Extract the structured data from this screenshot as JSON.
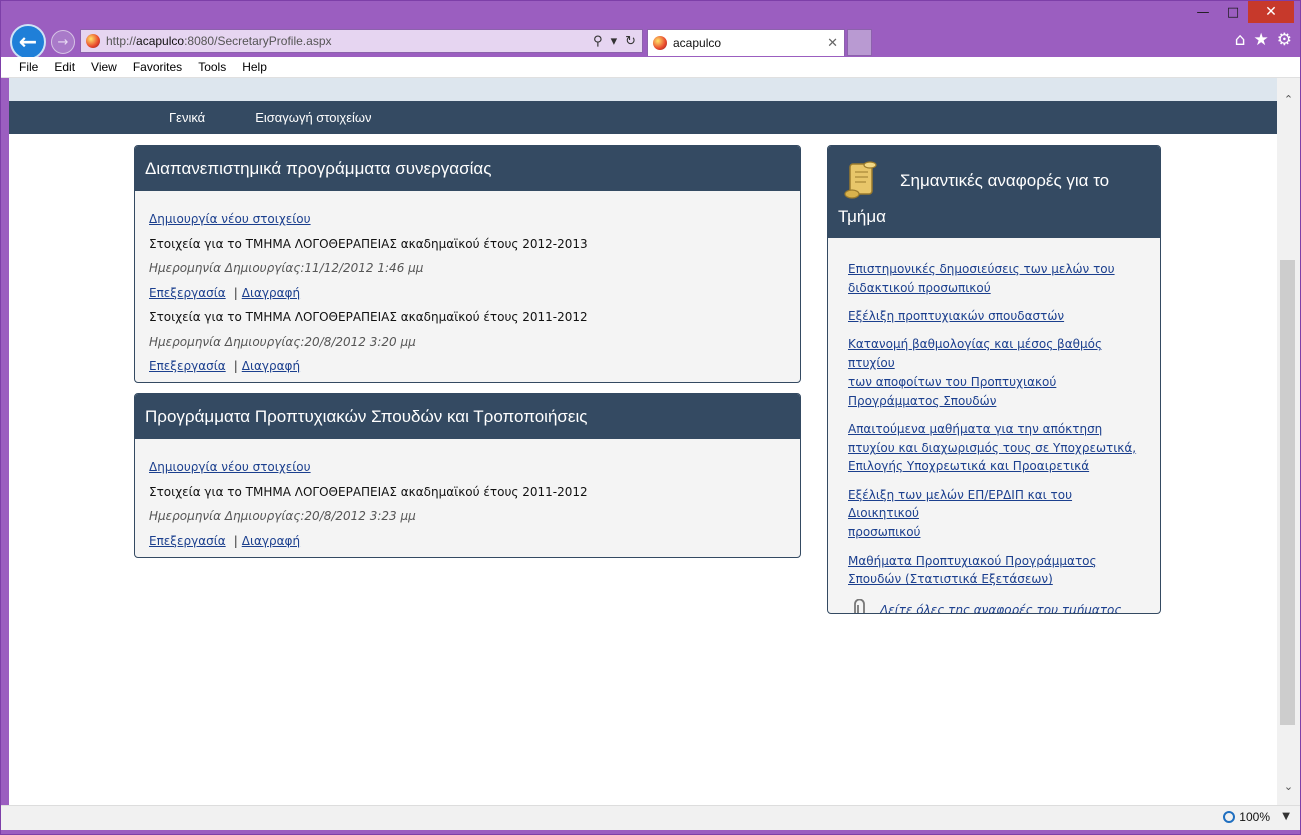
{
  "browser": {
    "url_prefix": "http://",
    "url_host": "acapulco",
    "url_rest": ":8080/SecretaryProfile.aspx",
    "tab_title": "acapulco",
    "menu": [
      "File",
      "Edit",
      "View",
      "Favorites",
      "Tools",
      "Help"
    ],
    "zoom": "100%"
  },
  "nav": {
    "items": [
      "Γενικά",
      "Εισαγωγή στοιχείων"
    ]
  },
  "panel1": {
    "title": "Διαπανεπιστημικά προγράμματα συνεργασίας",
    "create_link": "Δημιουργία νέου στοιχείου",
    "entries": [
      {
        "text": "Στοιχεία για το ΤΜΗΜΑ ΛΟΓΟΘΕΡΑΠΕΙΑΣ ακαδημαϊκού έτους 2012-2013",
        "date": "Ημερομηνία Δημιουργίας:11/12/2012 1:46 μμ",
        "edit": "Επεξεργασία",
        "delete": "Διαγραφή",
        "sep": "|"
      },
      {
        "text": "Στοιχεία για το ΤΜΗΜΑ ΛΟΓΟΘΕΡΑΠΕΙΑΣ ακαδημαϊκού έτους 2011-2012",
        "date": "Ημερομηνία Δημιουργίας:20/8/2012 3:20 μμ",
        "edit": "Επεξεργασία",
        "delete": "Διαγραφή",
        "sep": "|"
      }
    ]
  },
  "panel2": {
    "title": "Προγράμματα Προπτυχιακών Σπουδών και Τροποποιήσεις",
    "create_link": "Δημιουργία νέου στοιχείου",
    "entries": [
      {
        "text": "Στοιχεία για το ΤΜΗΜΑ ΛΟΓΟΘΕΡΑΠΕΙΑΣ ακαδημαϊκού έτους 2011-2012",
        "date": "Ημερομηνία Δημιουργίας:20/8/2012 3:23 μμ",
        "edit": "Επεξεργασία",
        "delete": "Διαγραφή",
        "sep": "|"
      }
    ]
  },
  "reports": {
    "title_line1": "Σημαντικές αναφορές για το",
    "title_line2": "Τμήμα",
    "links": [
      [
        "Επιστημονικές δημοσιεύσεις των μελών του",
        "διδακτικού προσωπικού"
      ],
      [
        "Εξέλιξη προπτυχιακών σπουδαστών"
      ],
      [
        "Κατανομή βαθμολογίας και μέσος βαθμός πτυχίου",
        "των αποφοίτων του Προπτυχιακού",
        "Προγράμματος Σπουδών"
      ],
      [
        "Απαιτούμενα μαθήματα για την απόκτηση",
        "πτυχίου και διαχωρισμός τους σε Υποχρεωτικά,",
        "Επιλογής Υποχρεωτικά και Προαιρετικά"
      ],
      [
        "Εξέλιξη των μελών ΕΠ/ΕΡΔΙΠ και του Διοικητικού",
        "προσωπικού"
      ],
      [
        "Μαθήματα Προπτυχιακού Προγράμματος",
        "Σπουδών (Στατιστικά Εξετάσεων)"
      ]
    ],
    "all_link": "Δείτε όλες της αναφορές του τμήματος"
  }
}
